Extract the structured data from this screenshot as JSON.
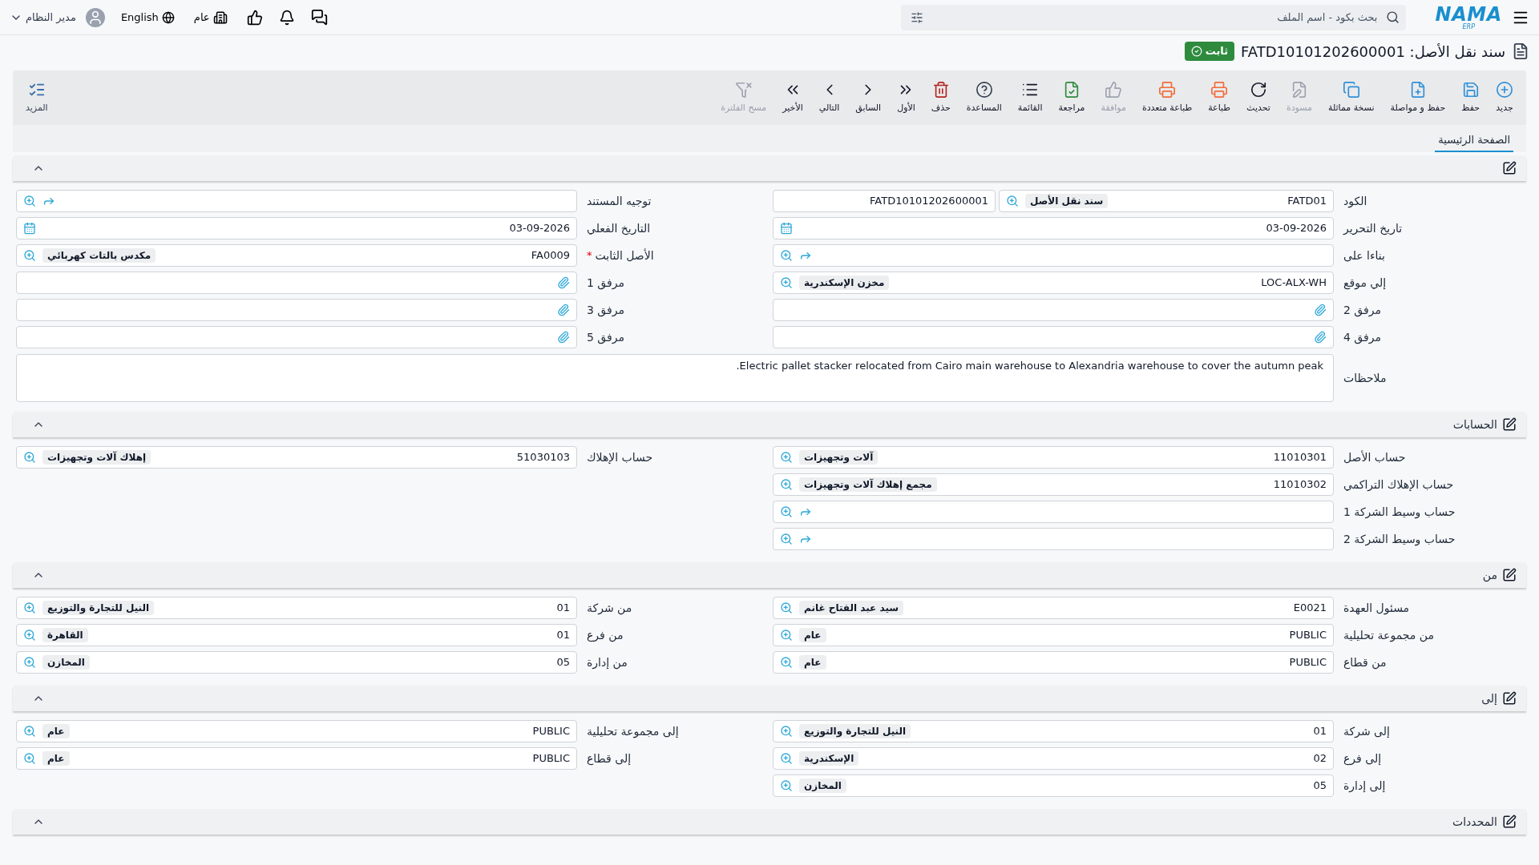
{
  "topbar": {
    "logo": {
      "name": "NAMA",
      "sub": "ERP"
    },
    "search": {
      "placeholder": "بحث بكود - اسم الملف"
    },
    "workspace": "عام",
    "language": "English",
    "user": "مدير النظام"
  },
  "title": {
    "text": "سند نقل الأصل: FATD10101202600001",
    "status": "ثابت"
  },
  "toolbar": [
    {
      "label": "جديد",
      "kind": "plus",
      "color": "#2f8fd8",
      "disabled": false
    },
    {
      "label": "حفظ",
      "kind": "save",
      "color": "#2f8fd8",
      "disabled": false
    },
    {
      "label": "حفظ و مواصلة",
      "kind": "fileplus",
      "color": "#2f8fd8",
      "disabled": false
    },
    {
      "label": "نسخة مماثلة",
      "kind": "copy",
      "color": "#2f8fd8",
      "disabled": false
    },
    {
      "label": "مسودة",
      "kind": "draft",
      "color": "#9ca3af",
      "disabled": true
    },
    {
      "label": "تحديث",
      "kind": "refresh",
      "color": "#111827",
      "disabled": false
    },
    {
      "label": "طباعة",
      "kind": "print",
      "color": "#f26b3a",
      "disabled": false
    },
    {
      "label": "طباعة متعددة",
      "kind": "printmulti",
      "color": "#f26b3a",
      "disabled": false
    },
    {
      "label": "موافقة",
      "kind": "approve",
      "color": "#9ca3af",
      "disabled": true
    },
    {
      "label": "مراجعة",
      "kind": "review",
      "color": "#2e8b3e",
      "disabled": false
    },
    {
      "label": "القائمة",
      "kind": "list",
      "color": "#111827",
      "disabled": false
    },
    {
      "label": "المساعدة",
      "kind": "help",
      "color": "#374151",
      "disabled": false
    },
    {
      "label": "حذف",
      "kind": "delete",
      "color": "#b3261e",
      "disabled": false
    },
    {
      "label": "الأول",
      "kind": "first",
      "color": "#111827",
      "disabled": false
    },
    {
      "label": "السابق",
      "kind": "prev",
      "color": "#111827",
      "disabled": false
    },
    {
      "label": "التالي",
      "kind": "next",
      "color": "#111827",
      "disabled": false
    },
    {
      "label": "الأخير",
      "kind": "last",
      "color": "#111827",
      "disabled": false
    },
    {
      "label": "مسح الفلترة",
      "kind": "clearfilter",
      "color": "#9ca3af",
      "disabled": true
    }
  ],
  "more": {
    "label": "المزيد"
  },
  "tabs": [
    {
      "label": "الصفحة الرئيسية",
      "selected": true
    }
  ],
  "sections": [
    {
      "expanded": true,
      "columns": [
        [
          {
            "label": "الكود",
            "kind": "code",
            "value": "FATD01",
            "chip": "سند نقل الأصل",
            "doc": "FATD10101202600001"
          },
          {
            "label": "تاريخ التحرير",
            "kind": "date",
            "value": "03-09-2026"
          },
          {
            "label": "بناءا على",
            "kind": "lookup"
          },
          {
            "label": "إلي موقع",
            "kind": "lookup",
            "value": "LOC-ALX-WH",
            "chip": "مخزن الإسكندرية"
          },
          {
            "label": "مرفق 2",
            "kind": "attachment"
          },
          {
            "label": "مرفق 4",
            "kind": "attachment"
          }
        ],
        [
          {
            "label": "توجيه المستند",
            "kind": "lookup"
          },
          {
            "label": "التاريخ الفعلي",
            "kind": "date",
            "value": "03-09-2026"
          },
          {
            "label": "الأصل الثابت",
            "required_mark": "*",
            "kind": "lookup",
            "value": "FA0009",
            "chip": "مكدس بالتات كهربائي"
          },
          {
            "label": "مرفق 1",
            "kind": "attachment"
          },
          {
            "label": "مرفق 3",
            "kind": "attachment"
          },
          {
            "label": "مرفق 5",
            "kind": "attachment"
          }
        ]
      ],
      "notes": {
        "label": "ملاحظات",
        "value": "Electric pallet stacker relocated from Cairo main warehouse to Alexandria warehouse to cover the autumn peak."
      }
    },
    {
      "title": "الحسابات",
      "expanded": true,
      "columns": [
        [
          {
            "label": "حساب الأصل",
            "kind": "lookup",
            "value": "11010301",
            "chip": "آلات وتجهيزات"
          },
          {
            "label": "حساب الإهلاك التراكمي",
            "kind": "lookup",
            "value": "11010302",
            "chip": "مجمع إهلاك آلات وتجهيزات"
          },
          {
            "label": "حساب وسيط الشركة 1",
            "kind": "lookup"
          },
          {
            "label": "حساب وسيط الشركة 2",
            "kind": "lookup"
          }
        ],
        [
          {
            "label": "حساب الإهلاك",
            "kind": "lookup",
            "value": "51030103",
            "chip": "إهلاك آلات وتجهيزات"
          }
        ]
      ]
    },
    {
      "title": "من",
      "expanded": true,
      "columns": [
        [
          {
            "label": "مسئول العهدة",
            "kind": "lookup",
            "value": "E0021",
            "chip": "سيد عبد الفتاح غانم"
          },
          {
            "label": "من مجموعة تحليلية",
            "kind": "lookup",
            "value": "PUBLIC",
            "chip": "عام"
          },
          {
            "label": "من قطاع",
            "kind": "lookup",
            "value": "PUBLIC",
            "chip": "عام"
          }
        ],
        [
          {
            "label": "من شركة",
            "kind": "lookup",
            "value": "01",
            "chip": "النيل للتجارة والتوزيع"
          },
          {
            "label": "من فرع",
            "kind": "lookup",
            "value": "01",
            "chip": "القاهرة"
          },
          {
            "label": "من إدارة",
            "kind": "lookup",
            "value": "05",
            "chip": "المخازن"
          }
        ]
      ]
    },
    {
      "title": "إلى",
      "expanded": true,
      "columns": [
        [
          {
            "label": "إلى شركة",
            "kind": "lookup",
            "value": "01",
            "chip": "النيل للتجارة والتوزيع"
          },
          {
            "label": "إلى فرع",
            "kind": "lookup",
            "value": "02",
            "chip": "الإسكندرية"
          },
          {
            "label": "إلى إدارة",
            "kind": "lookup",
            "value": "05",
            "chip": "المخازن"
          }
        ],
        [
          {
            "label": "إلى مجموعة تحليلية",
            "kind": "lookup",
            "value": "PUBLIC",
            "chip": "عام"
          },
          {
            "label": "إلى قطاع",
            "kind": "lookup",
            "value": "PUBLIC",
            "chip": "عام"
          }
        ]
      ]
    },
    {
      "title": "المحددات",
      "expanded": true,
      "columns": [
        [],
        []
      ]
    }
  ]
}
